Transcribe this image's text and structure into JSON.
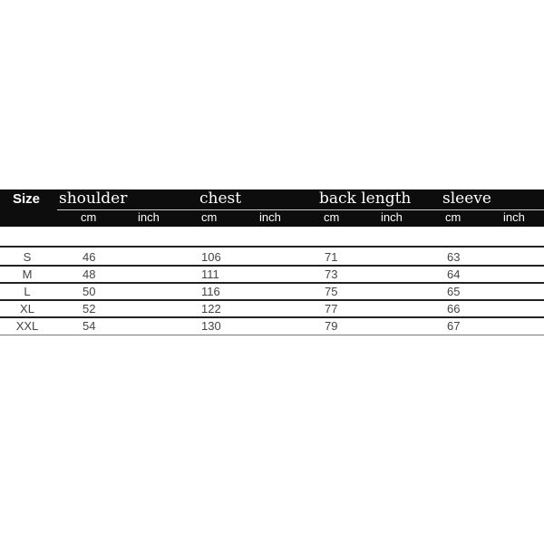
{
  "header": {
    "size_label": "Size",
    "groups": [
      {
        "label": "shoulder",
        "units": [
          "cm",
          "inch"
        ]
      },
      {
        "label": "chest",
        "units": [
          "cm",
          "inch"
        ]
      },
      {
        "label": "back length",
        "units": [
          "cm",
          "inch"
        ]
      },
      {
        "label": "sleeve",
        "units": [
          "cm",
          "inch"
        ]
      }
    ]
  },
  "rows": [
    {
      "size": "S",
      "shoulder": "46",
      "chest": "106",
      "back_length": "71",
      "sleeve": "63"
    },
    {
      "size": "M",
      "shoulder": "48",
      "chest": "111",
      "back_length": "73",
      "sleeve": "64"
    },
    {
      "size": "L",
      "shoulder": "50",
      "chest": "116",
      "back_length": "75",
      "sleeve": "65"
    },
    {
      "size": "XL",
      "shoulder": "52",
      "chest": "122",
      "back_length": "77",
      "sleeve": "66"
    },
    {
      "size": "XXL",
      "shoulder": "54",
      "chest": "130",
      "back_length": "79",
      "sleeve": "67"
    }
  ]
}
